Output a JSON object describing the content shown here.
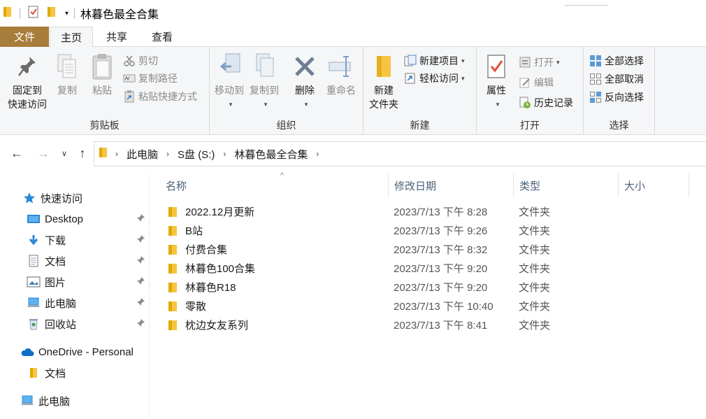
{
  "window": {
    "title": "林暮色最全合集"
  },
  "ribbon_tabs": {
    "file": "文件",
    "home": "主页",
    "share": "共享",
    "view": "查看"
  },
  "clipboard": {
    "pin_l1": "固定到",
    "pin_l2": "快速访问",
    "copy": "复制",
    "paste": "粘贴",
    "cut": "剪切",
    "copy_path": "复制路径",
    "paste_shortcut": "粘贴快捷方式",
    "label": "剪贴板"
  },
  "organize": {
    "move_to": "移动到",
    "copy_to": "复制到",
    "delete": "删除",
    "rename": "重命名",
    "label": "组织"
  },
  "new_group": {
    "new_folder_l1": "新建",
    "new_folder_l2": "文件夹",
    "new_item": "新建项目",
    "easy_access": "轻松访问",
    "label": "新建"
  },
  "open_group": {
    "properties": "属性",
    "open": "打开",
    "edit": "编辑",
    "history": "历史记录",
    "label": "打开"
  },
  "select_group": {
    "select_all": "全部选择",
    "select_none": "全部取消",
    "invert": "反向选择",
    "label": "选择"
  },
  "address": {
    "crumbs": [
      "此电脑",
      "S盘 (S:)",
      "林暮色最全合集"
    ]
  },
  "sidebar": {
    "quick_access": "快速访问",
    "items": [
      "Desktop",
      "下载",
      "文档",
      "图片",
      "此电脑",
      "回收站"
    ],
    "onedrive": "OneDrive - Personal",
    "onedrive_docs": "文档",
    "this_pc": "此电脑"
  },
  "columns": {
    "name": "名称",
    "date": "修改日期",
    "type": "类型",
    "size": "大小"
  },
  "files": [
    {
      "name": "2022.12月更新",
      "date": "2023/7/13 下午 8:28",
      "type": "文件夹"
    },
    {
      "name": "B站",
      "date": "2023/7/13 下午 9:26",
      "type": "文件夹"
    },
    {
      "name": "付费合集",
      "date": "2023/7/13 下午 8:32",
      "type": "文件夹"
    },
    {
      "name": "林暮色100合集",
      "date": "2023/7/13 下午 9:20",
      "type": "文件夹"
    },
    {
      "name": "林暮色R18",
      "date": "2023/7/13 下午 9:20",
      "type": "文件夹"
    },
    {
      "name": "零散",
      "date": "2023/7/13 下午 10:40",
      "type": "文件夹"
    },
    {
      "name": "枕边女友系列",
      "date": "2023/7/13 下午 8:41",
      "type": "文件夹"
    }
  ],
  "colors": {
    "file_tab": "#a87c3a",
    "folder": "#f5c542",
    "accent": "#0078d7"
  }
}
